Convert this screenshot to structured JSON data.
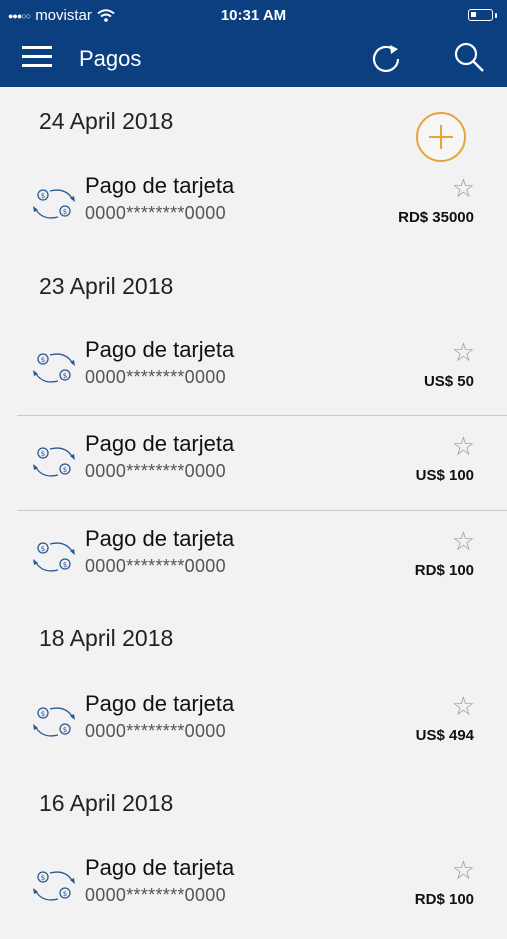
{
  "status_bar": {
    "carrier": "movistar",
    "time": "10:31 AM"
  },
  "nav": {
    "title": "Pagos",
    "menu_icon": "menu-icon",
    "refresh_icon": "refresh-icon",
    "search_icon": "search-icon"
  },
  "colors": {
    "header": "#0b3f7f",
    "accent": "#e8a33d"
  },
  "groups": [
    {
      "date": "24 April 2018",
      "items": [
        {
          "name": "Pago de tarjeta",
          "account": "0000********0000",
          "amount": "RD$ 35000"
        }
      ]
    },
    {
      "date": "23 April 2018",
      "items": [
        {
          "name": "Pago de tarjeta",
          "account": "0000********0000",
          "amount": "US$ 50"
        },
        {
          "name": "Pago de tarjeta",
          "account": "0000********0000",
          "amount": "US$ 100"
        },
        {
          "name": "Pago de tarjeta",
          "account": "0000********0000",
          "amount": "RD$ 100"
        }
      ]
    },
    {
      "date": "18 April 2018",
      "items": [
        {
          "name": "Pago de tarjeta",
          "account": "0000********0000",
          "amount": "US$ 494"
        }
      ]
    },
    {
      "date": "16 April 2018",
      "items": [
        {
          "name": "Pago de tarjeta",
          "account": "0000********0000",
          "amount": "RD$ 100"
        }
      ]
    }
  ]
}
